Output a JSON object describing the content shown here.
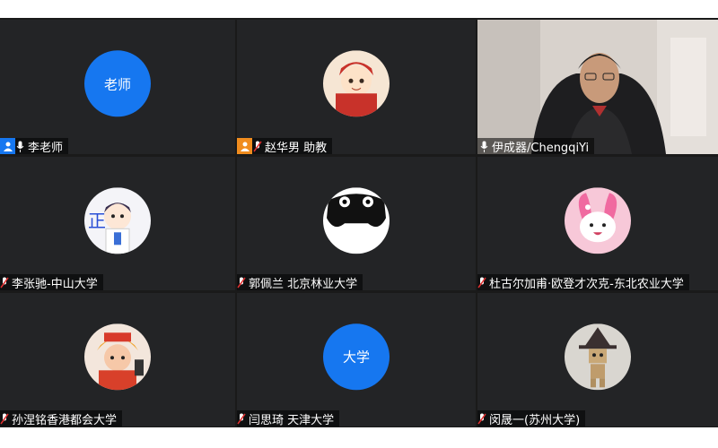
{
  "participants": [
    {
      "name": "李老师",
      "avatar_text": "老师",
      "role": "host",
      "mic": "on"
    },
    {
      "name": "赵华男 助教",
      "avatar_icon": "cartoon-girl-avatar",
      "role": "co-host",
      "mic": "on"
    },
    {
      "name": "伊成器/ChengqiYi",
      "video": "on",
      "mic": "on"
    },
    {
      "name": "李张驰-中山大学",
      "avatar_icon": "cartoon-boy-avatar",
      "mic": "muted"
    },
    {
      "name": "郭佩兰 北京林业大学",
      "avatar_icon": "black-cat-avatar",
      "mic": "muted"
    },
    {
      "name": "杜古尔加甫·欧登才次克-东北农业大学",
      "avatar_icon": "pink-rabbit-avatar",
      "mic": "muted"
    },
    {
      "name": "孙涅铭香港都会大学",
      "avatar_icon": "tiger-hat-avatar",
      "mic": "muted"
    },
    {
      "name": "闫思琦 天津大学",
      "avatar_text": "大学",
      "mic": "muted"
    },
    {
      "name": "闵晟一(苏州大学)",
      "avatar_icon": "cardboard-robot-avatar",
      "mic": "muted"
    }
  ],
  "colors": {
    "avatar_blue": "#1677f0",
    "host_badge": "#1677f0",
    "cohost_badge": "#f08c1e",
    "active_border": "#7fd07f"
  }
}
